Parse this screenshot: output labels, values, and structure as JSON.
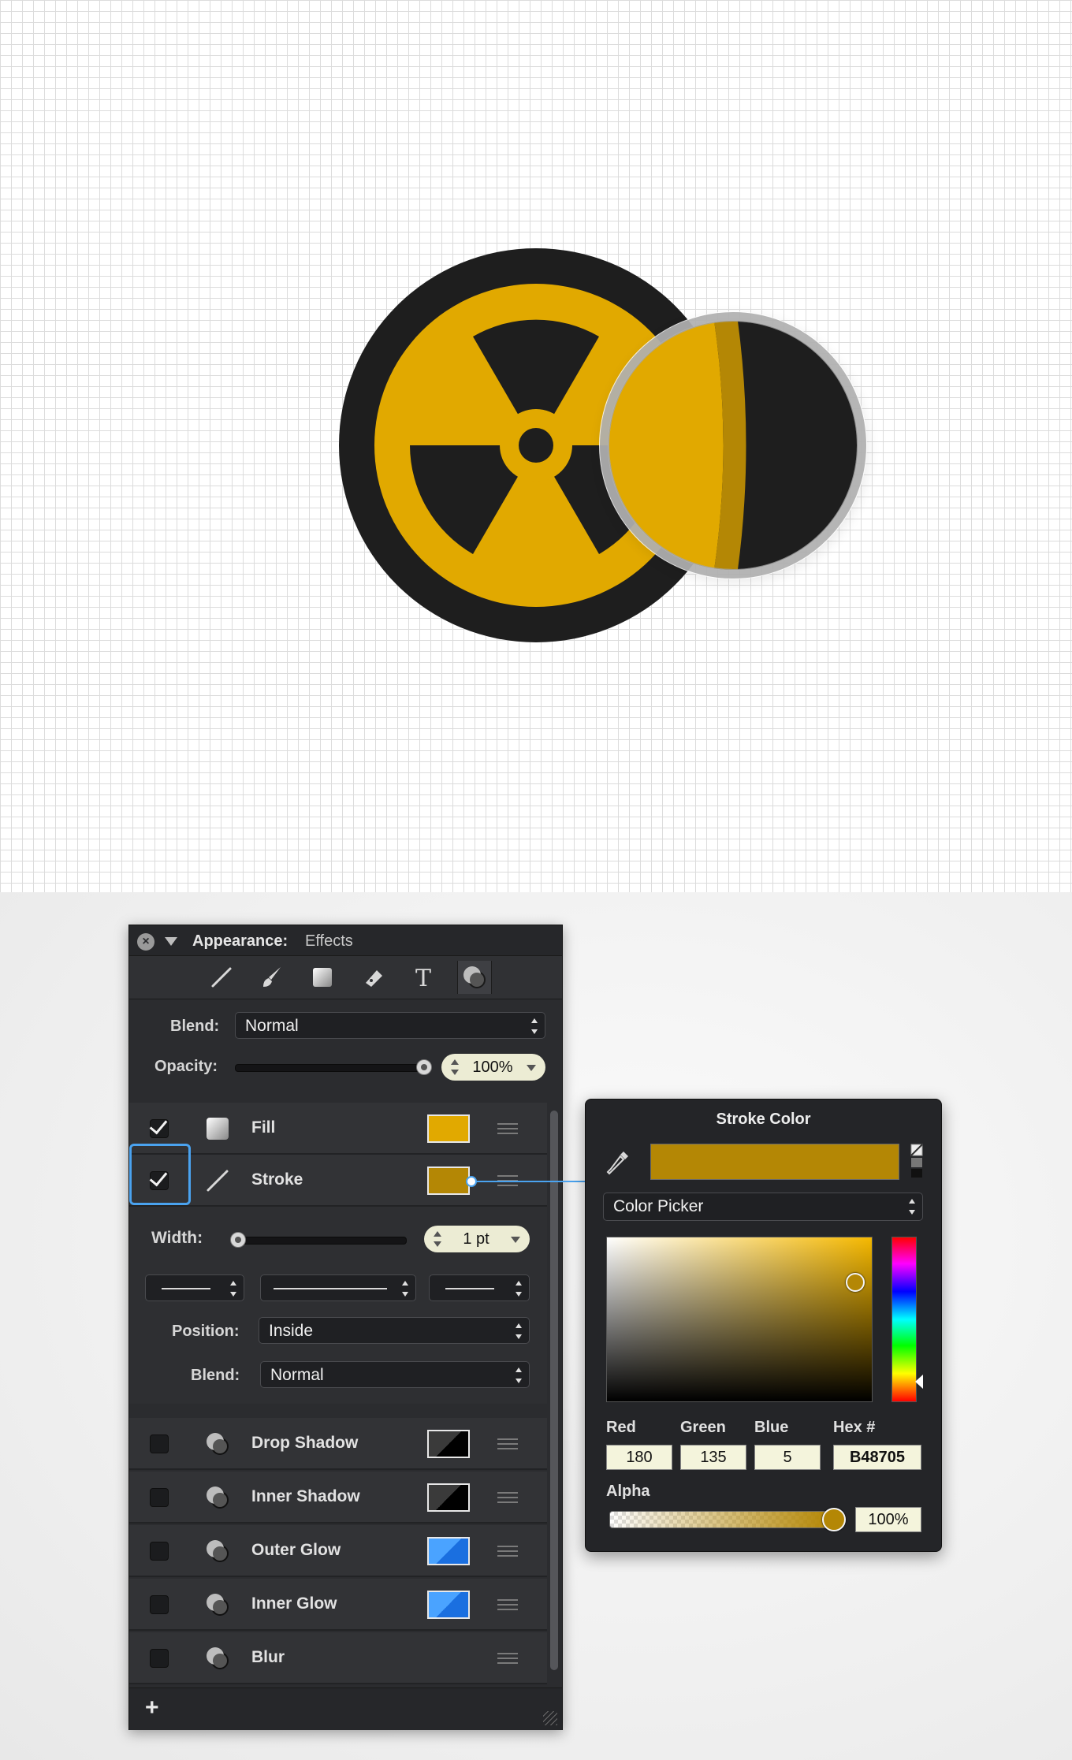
{
  "colors": {
    "accent_yellow": "#e1a900",
    "stroke_color": "#b48705",
    "dark": "#1e1e1e",
    "glow_blue": "#2d8cff",
    "highlight_blue": "#4aa3f0"
  },
  "appearance": {
    "title": "Appearance:",
    "subtitle": "Effects",
    "toolbar_icons": [
      "stroke-tool-icon",
      "brush-tool-icon",
      "fill-tool-icon",
      "eraser-tool-icon",
      "text-tool-icon",
      "effects-tool-icon"
    ],
    "blend_label": "Blend:",
    "blend_value": "Normal",
    "opacity_label": "Opacity:",
    "opacity_value": "100%",
    "opacity_level": 1.0,
    "layers": [
      {
        "name": "Fill",
        "checked": true,
        "swatch": "#e1a900"
      },
      {
        "name": "Stroke",
        "checked": true,
        "swatch": "#b48705"
      },
      {
        "name": "Drop Shadow",
        "checked": false,
        "swatch": "#000000"
      },
      {
        "name": "Inner Shadow",
        "checked": false,
        "swatch": "#000000"
      },
      {
        "name": "Outer Glow",
        "checked": false,
        "swatch": "#2d8cff"
      },
      {
        "name": "Inner Glow",
        "checked": false,
        "swatch": "#2d8cff"
      },
      {
        "name": "Blur",
        "checked": false,
        "swatch": null
      }
    ],
    "stroke": {
      "width_label": "Width:",
      "width_value": "1 pt",
      "position_label": "Position:",
      "position_value": "Inside",
      "blend_label": "Blend:",
      "blend_value": "Normal"
    },
    "add_label": "+"
  },
  "stroke_color": {
    "title": "Stroke Color",
    "mode": "Color Picker",
    "red_label": "Red",
    "red": "180",
    "green_label": "Green",
    "green": "135",
    "blue_label": "Blue",
    "blue": "5",
    "hex_label": "Hex #",
    "hex": "B48705",
    "alpha_label": "Alpha",
    "alpha": "100%"
  }
}
